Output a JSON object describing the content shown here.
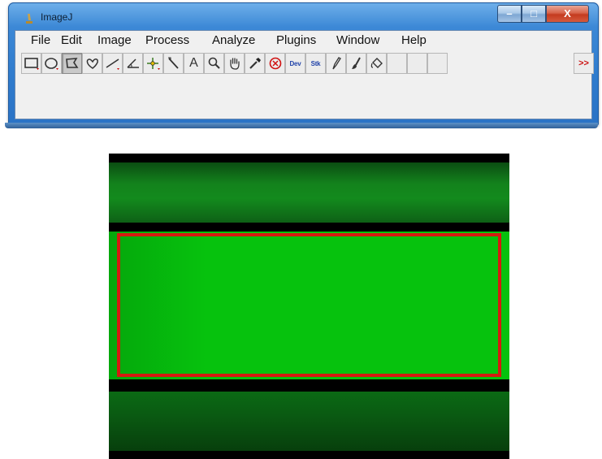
{
  "window": {
    "title": "ImageJ",
    "controls": {
      "minimize": "–",
      "maximize": "□",
      "close": "X"
    }
  },
  "menu": [
    "File",
    "Edit",
    "Image",
    "Process",
    "Analyze",
    "Plugins",
    "Window",
    "Help"
  ],
  "toolbar": {
    "tools": [
      {
        "name": "rectangle-tool",
        "icon": "rectangle-icon"
      },
      {
        "name": "oval-tool",
        "icon": "oval-icon"
      },
      {
        "name": "polygon-tool",
        "icon": "polygon-icon",
        "pressed": true
      },
      {
        "name": "freehand-tool",
        "icon": "freehand-icon"
      },
      {
        "name": "line-tool",
        "icon": "line-icon"
      },
      {
        "name": "angle-tool",
        "icon": "angle-icon"
      },
      {
        "name": "point-tool",
        "icon": "point-icon"
      },
      {
        "name": "wand-tool",
        "icon": "wand-icon"
      },
      {
        "name": "text-tool",
        "icon": "text-icon",
        "label": "A"
      },
      {
        "name": "zoom-tool",
        "icon": "magnifier-icon"
      },
      {
        "name": "hand-tool",
        "icon": "hand-icon"
      },
      {
        "name": "dropper-tool",
        "icon": "dropper-icon"
      },
      {
        "name": "clear-tool",
        "icon": "stop-icon"
      },
      {
        "name": "developer-menu",
        "icon": "dev-icon",
        "label": "Dev"
      },
      {
        "name": "stack-menu",
        "icon": "stk-icon",
        "label": "Stk"
      },
      {
        "name": "pencil-tool",
        "icon": "pencil-icon"
      },
      {
        "name": "brush-tool",
        "icon": "brush-icon"
      },
      {
        "name": "flood-fill-tool",
        "icon": "bucket-icon"
      },
      {
        "name": "empty-slot-1",
        "icon": ""
      },
      {
        "name": "empty-slot-2",
        "icon": ""
      },
      {
        "name": "more-tools",
        "icon": "double-chevron-icon",
        "label": ">>"
      }
    ]
  },
  "colors": {
    "roi_outline": "#d51a10",
    "fluorescence": "#06c20d",
    "titlebar": "#3c88d6"
  }
}
